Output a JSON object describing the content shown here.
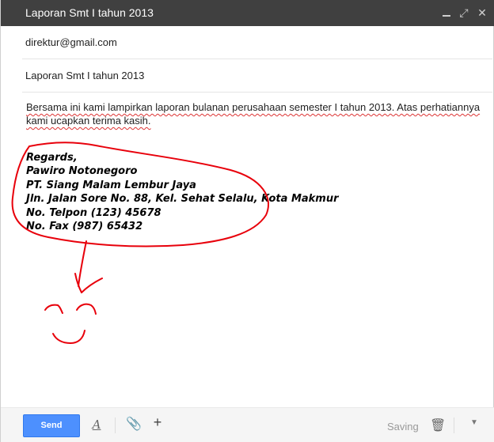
{
  "window": {
    "title": "Laporan Smt I tahun 2013",
    "controls": {
      "minimize": "minimize-icon",
      "maximize_glyph": "⤢",
      "close_glyph": "✕"
    }
  },
  "fields": {
    "to": "direktur@gmail.com",
    "subject": "Laporan Smt I tahun 2013"
  },
  "body": {
    "line1": "Bersama ini kami lampirkan laporan bulanan perusahaan semester I tahun 2013. Atas perhatiannya",
    "line2": "kami ucapkan terima kasih."
  },
  "signature": [
    "Regards,",
    "Pawiro Notonegoro",
    "PT. Siang Malam Lembur Jaya",
    "Jln. Jalan Sore No. 88, Kel. Sehat Selalu, Kota Makmur",
    "No. Telpon (123) 45678",
    "No. Fax (987) 65432"
  ],
  "toolbar": {
    "send_label": "Send",
    "format_glyph": "A",
    "attach_glyph": "📎",
    "plus_glyph": "+",
    "saving_label": "Saving",
    "trash_glyph": "🗑",
    "more_glyph": "▼"
  },
  "colors": {
    "titlebar": "#404040",
    "send": "#4d90fe",
    "ink": "#e8000b"
  }
}
